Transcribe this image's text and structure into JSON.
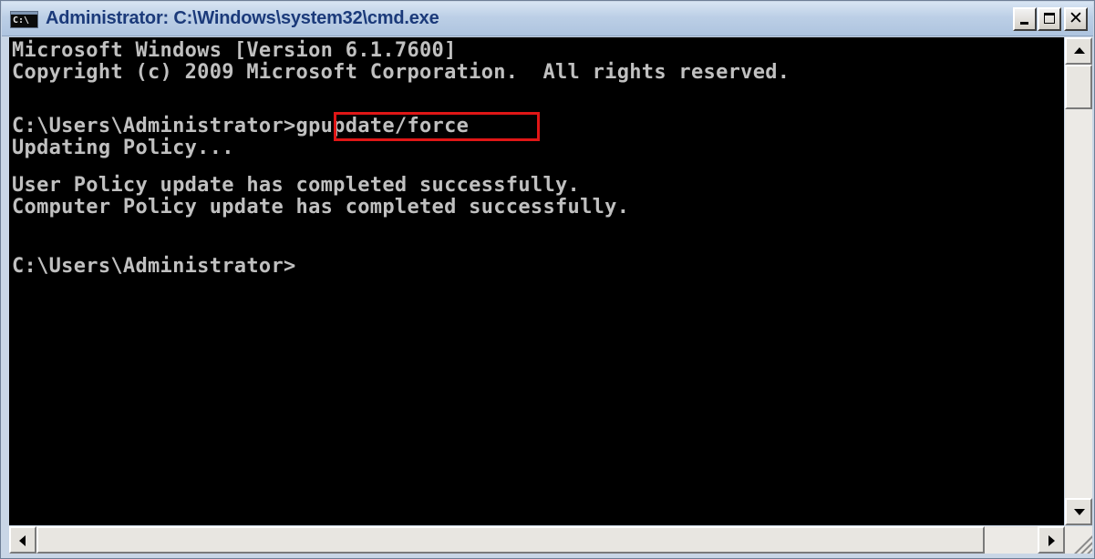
{
  "window": {
    "title": "Administrator: C:\\Windows\\system32\\cmd.exe",
    "icon_text": "C:\\",
    "icon": "console-icon",
    "caption_buttons": [
      "minimize",
      "maximize",
      "close"
    ]
  },
  "console": {
    "foreground_color": "#c0c0c0",
    "background_color": "#000000",
    "highlight_color": "#e01616",
    "lines": [
      "Microsoft Windows [Version 6.1.7600]",
      "Copyright (c) 2009 Microsoft Corporation.  All rights reserved.",
      "",
      "C:\\Users\\Administrator>gpupdate/force",
      "Updating Policy...",
      "",
      "User Policy update has completed successfully.",
      "Computer Policy update has completed successfully.",
      "",
      "",
      "C:\\Users\\Administrator>"
    ],
    "prompt": "C:\\Users\\Administrator>",
    "highlighted_command": "gpupdate/force"
  },
  "scrollbars": {
    "vertical": {
      "up_icon": "arrow-up-icon",
      "down_icon": "arrow-down-icon"
    },
    "horizontal": {
      "left_icon": "arrow-left-icon",
      "right_icon": "arrow-right-icon"
    }
  }
}
